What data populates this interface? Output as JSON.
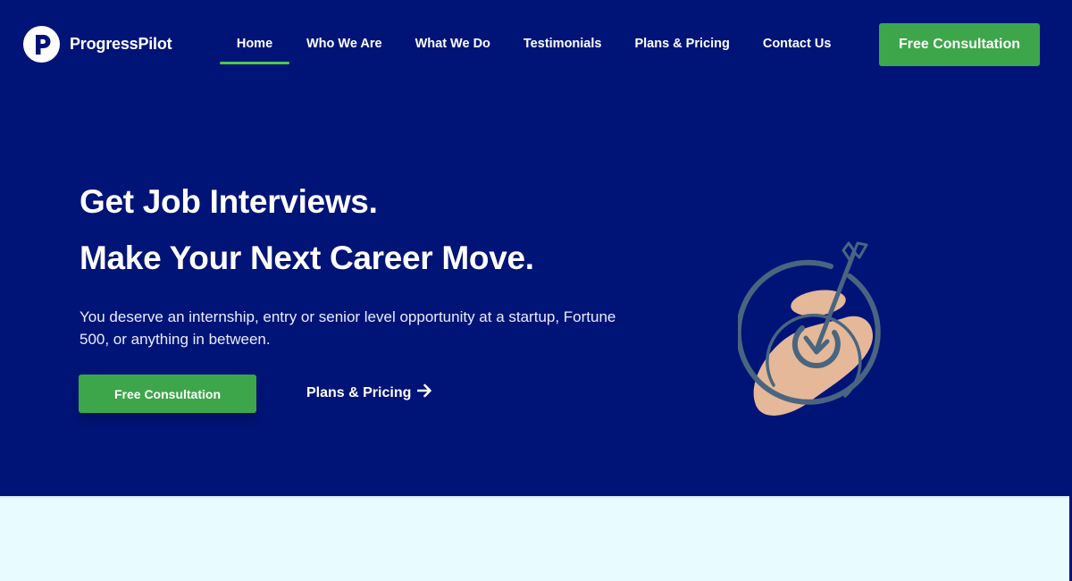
{
  "brand": {
    "name": "ProgressPilot",
    "logo_letter": "P",
    "logo_icon": "p-circle-logo-icon"
  },
  "nav": {
    "items": [
      {
        "label": "Home",
        "active": true
      },
      {
        "label": "Who We Are",
        "active": false
      },
      {
        "label": "What We Do",
        "active": false
      },
      {
        "label": "Testimonials",
        "active": false
      },
      {
        "label": "Plans & Pricing",
        "active": false
      },
      {
        "label": "Contact Us",
        "active": false
      }
    ],
    "cta_label": "Free Consultation"
  },
  "hero": {
    "headline_line1": "Get Job Interviews.",
    "headline_line2": "Make Your Next Career Move.",
    "subtext": "You deserve an internship, entry or senior level opportunity at a startup, Fortune 500, or anything in between.",
    "primary_cta_label": "Free Consultation",
    "secondary_link_label": "Plans & Pricing",
    "secondary_link_icon": "arrow-right-icon",
    "illustration": "target-arrow-illustration"
  },
  "colors": {
    "hero_background": "#001478",
    "accent_green": "#3da64a",
    "active_underline": "#4cc94c",
    "section_background": "#e8fbff",
    "illustration_stroke": "#4a6580",
    "illustration_fill": "#e4b898"
  }
}
